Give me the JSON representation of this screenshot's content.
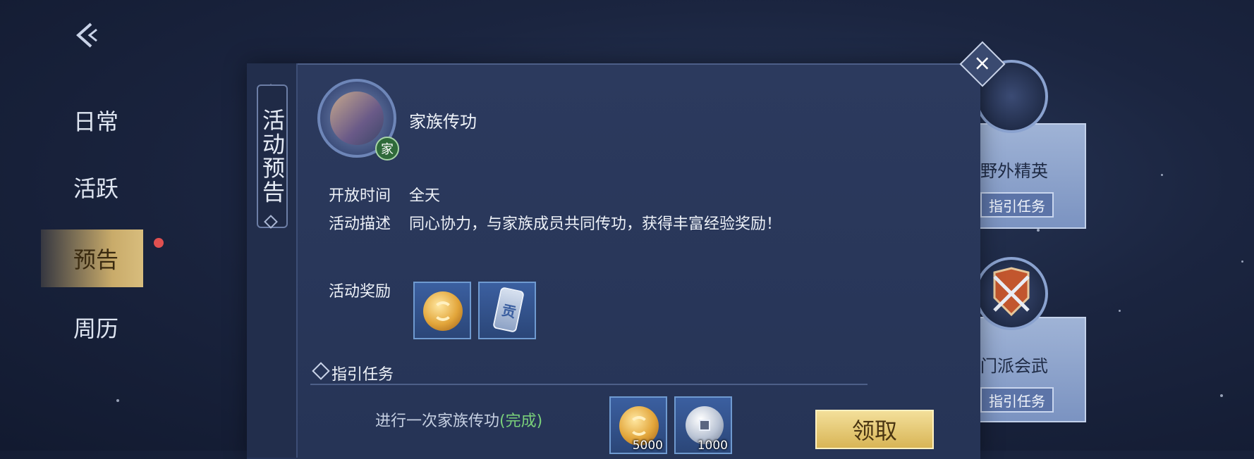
{
  "nav": {
    "items": [
      {
        "label": "日常"
      },
      {
        "label": "活跃"
      },
      {
        "label": "预告"
      },
      {
        "label": "周历"
      }
    ]
  },
  "panel": {
    "side_tab_label": "活动预告",
    "activity": {
      "badge": "家",
      "title": "家族传功",
      "open_time_label": "开放时间",
      "open_time_value": "全天",
      "desc_label": "活动描述",
      "desc_value": "同心协力，与家族成员共同传功，获得丰富经验奖励！",
      "reward_label": "活动奖励",
      "tag_char": "贡"
    },
    "guide": {
      "title": "指引任务",
      "task_prefix": "进行一次家族传功",
      "task_status": "(完成)",
      "rewards": [
        {
          "qty": "5000"
        },
        {
          "qty": "1000"
        }
      ],
      "claim_label": "领取"
    }
  },
  "cards": [
    {
      "name": "野外精英",
      "button": "指引任务"
    },
    {
      "name": "门派会武",
      "button": "指引任务"
    }
  ],
  "colors": {
    "accent_gold": "#d8b556",
    "done_green": "#7ad07a",
    "badge_red": "#e05050"
  }
}
